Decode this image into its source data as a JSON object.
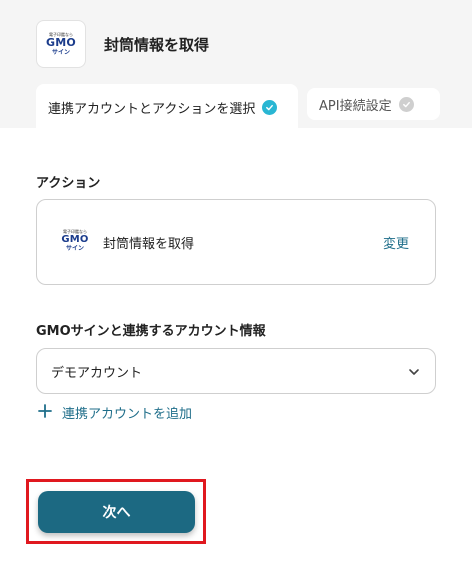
{
  "header": {
    "app_title": "封筒情報を取得",
    "logo": {
      "tagline": "電子印鑑なら",
      "brand": "GMO",
      "product": "サイン"
    }
  },
  "tabs": [
    {
      "label": "連携アカウントとアクションを選択",
      "status": "complete",
      "active": true
    },
    {
      "label": "API接続設定",
      "status": "incomplete",
      "active": false
    }
  ],
  "action_section": {
    "label": "アクション",
    "card": {
      "title": "封筒情報を取得",
      "change_label": "変更"
    }
  },
  "account_section": {
    "label": "GMOサインと連携するアカウント情報",
    "selected_value": "デモアカウント",
    "add_account_label": "連携アカウントを追加"
  },
  "footer": {
    "next_label": "次へ"
  },
  "colors": {
    "accent": "#1c6982",
    "link": "#1f6e8a",
    "check_active": "#29b6d3",
    "highlight_border": "#e0181f",
    "header_bg": "#f5f5f5"
  }
}
